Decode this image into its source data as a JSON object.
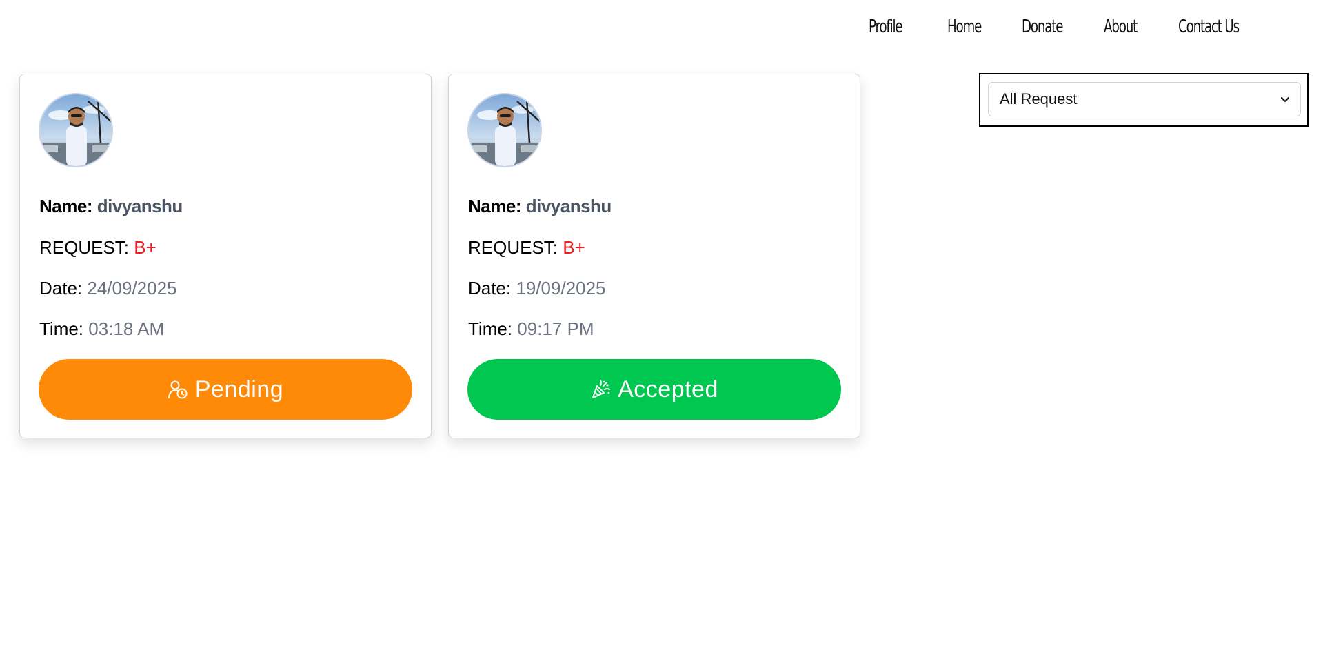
{
  "nav": {
    "items": [
      "Profile",
      "Home",
      "Donate",
      "About",
      "Contact Us"
    ]
  },
  "filter": {
    "selected": "All Request"
  },
  "cards": [
    {
      "name_label": "Name:",
      "name": "divyanshu",
      "request_label": "REQUEST:",
      "request": "B+",
      "date_label": "Date:",
      "date": "24/09/2025",
      "time_label": "Time:",
      "time": "03:18 AM",
      "status": "Pending",
      "status_color": "#ff8a08",
      "status_icon": "user-clock-icon"
    },
    {
      "name_label": "Name:",
      "name": "divyanshu",
      "request_label": "REQUEST:",
      "request": "B+",
      "date_label": "Date:",
      "date": "19/09/2025",
      "time_label": "Time:",
      "time": "09:17 PM",
      "status": "Accepted",
      "status_color": "#00c74f",
      "status_icon": "party-popper-icon"
    }
  ]
}
